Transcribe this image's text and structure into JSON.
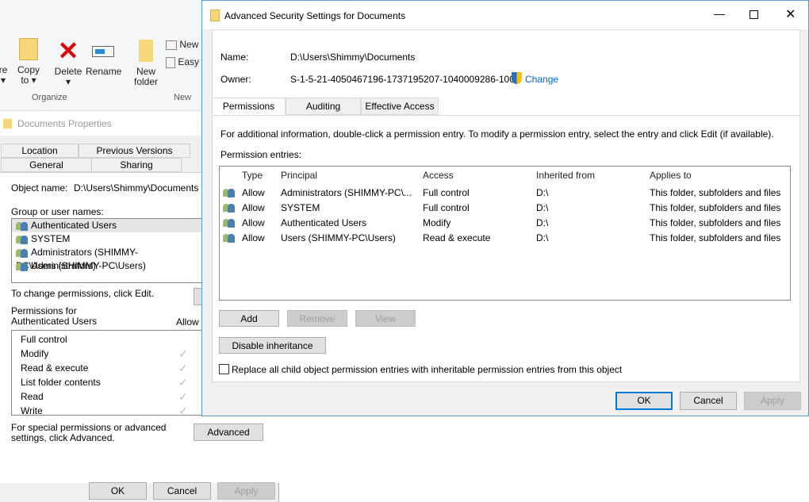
{
  "ribbon": {
    "buttons": [
      {
        "label": "Copy\nto ▾"
      },
      {
        "label": "Delete\n▾"
      },
      {
        "label": "Rename"
      },
      {
        "label": "New\nfolder"
      }
    ],
    "small": [
      "New",
      "Easy"
    ],
    "groups": [
      "Organize",
      "New"
    ],
    "partial": "re\n▾"
  },
  "properties": {
    "title": "Documents Properties",
    "tabs_top": [
      "Location",
      "Previous Versions"
    ],
    "tabs_bottom": [
      "General",
      "Sharing"
    ],
    "object_label": "Object name:",
    "object_value": "D:\\Users\\Shimmy\\Documents",
    "group_label": "Group or user names:",
    "users": [
      "Authenticated Users",
      "SYSTEM",
      "Administrators (SHIMMY-PC\\Administrators)",
      "Users (SHIMMY-PC\\Users)"
    ],
    "change_text": "To change permissions, click Edit.",
    "perm_label": "Permissions for Authenticated Users",
    "allow": "Allow",
    "perms": [
      {
        "name": "Full control",
        "allow": false
      },
      {
        "name": "Modify",
        "allow": true
      },
      {
        "name": "Read & execute",
        "allow": true
      },
      {
        "name": "List folder contents",
        "allow": true
      },
      {
        "name": "Read",
        "allow": true
      },
      {
        "name": "Write",
        "allow": true
      }
    ],
    "special_text": "For special permissions or advanced settings, click Advanced.",
    "advanced": "Advanced",
    "ok": "OK",
    "cancel": "Cancel",
    "apply": "Apply"
  },
  "advanced": {
    "title": "Advanced Security Settings for Documents",
    "name_label": "Name:",
    "name_value": "D:\\Users\\Shimmy\\Documents",
    "owner_label": "Owner:",
    "owner_value": "S-1-5-21-4050467196-1737195207-1040009286-1002",
    "change": "Change",
    "tabs": [
      "Permissions",
      "Auditing",
      "Effective Access"
    ],
    "info": "For additional information, double-click a permission entry. To modify a permission entry, select the entry and click Edit (if available).",
    "entries_label": "Permission entries:",
    "columns": [
      "Type",
      "Principal",
      "Access",
      "Inherited from",
      "Applies to"
    ],
    "rows": [
      [
        "Allow",
        "Administrators (SHIMMY-PC\\...",
        "Full control",
        "D:\\",
        "This folder, subfolders and files"
      ],
      [
        "Allow",
        "SYSTEM",
        "Full control",
        "D:\\",
        "This folder, subfolders and files"
      ],
      [
        "Allow",
        "Authenticated Users",
        "Modify",
        "D:\\",
        "This folder, subfolders and files"
      ],
      [
        "Allow",
        "Users (SHIMMY-PC\\Users)",
        "Read & execute",
        "D:\\",
        "This folder, subfolders and files"
      ]
    ],
    "add": "Add",
    "remove": "Remove",
    "view": "View",
    "disable": "Disable inheritance",
    "replace": "Replace all child object permission entries with inheritable permission entries from this object",
    "ok": "OK",
    "cancel": "Cancel",
    "apply": "Apply",
    "accent": "#0078d7"
  }
}
